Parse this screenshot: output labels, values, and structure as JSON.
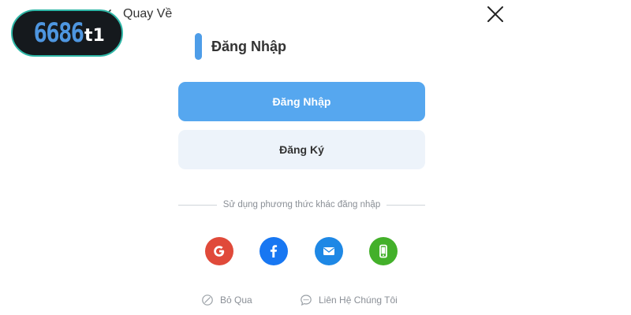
{
  "header": {
    "back_label": "Quay Về"
  },
  "logo": {
    "number": "6686",
    "suffix": "t1"
  },
  "title": "Đăng Nhập",
  "buttons": {
    "login": "Đăng Nhập",
    "register": "Đăng Ký"
  },
  "divider_text": "Sử dụng phương thức khác đăng nhập",
  "social": [
    {
      "icon": "google-icon",
      "color": "#e04a3a"
    },
    {
      "icon": "facebook-icon",
      "color": "#1877f2"
    },
    {
      "icon": "email-icon",
      "color": "#1e88e5"
    },
    {
      "icon": "phone-icon",
      "color": "#43b02a"
    }
  ],
  "footer": {
    "skip": "Bỏ Qua",
    "contact": "Liên Hệ Chúng Tôi"
  },
  "colors": {
    "accent": "#56a7ef",
    "logo_bg": "#15191d",
    "logo_border": "#2fb7a7"
  }
}
